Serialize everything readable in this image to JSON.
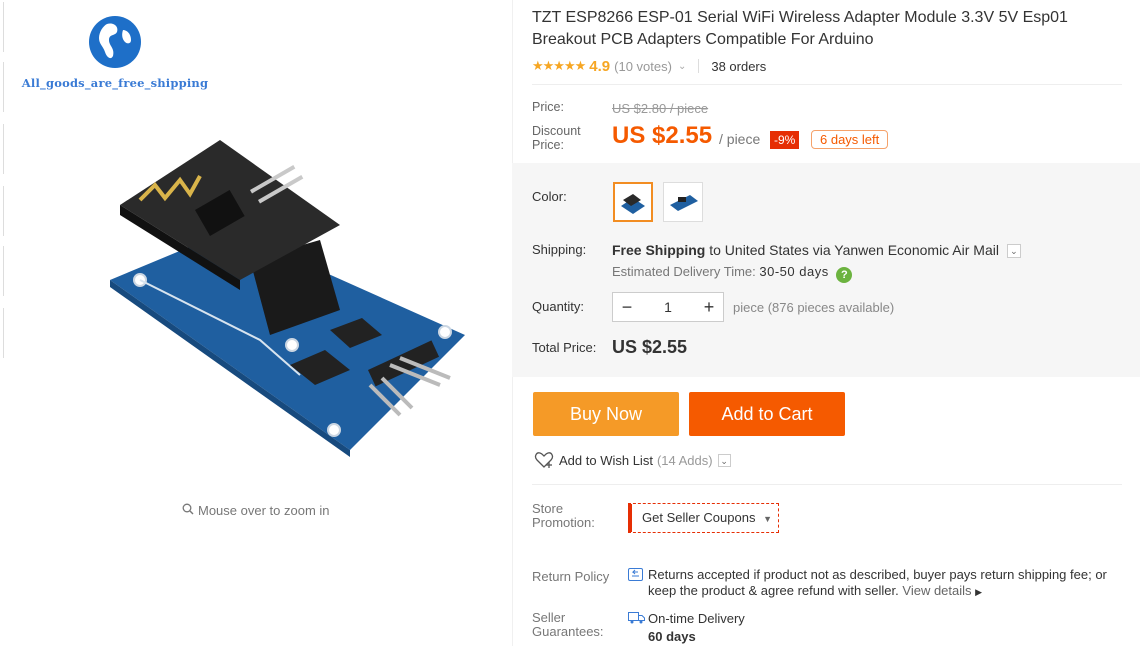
{
  "store": {
    "logo_text": "All_goods_are_free_shipping"
  },
  "gallery": {
    "zoom_hint": "Mouse over to zoom in"
  },
  "product": {
    "title": "TZT ESP8266 ESP-01 Serial WiFi Wireless Adapter Module 3.3V 5V Esp01 Breakout PCB Adapters Compatible For Arduino",
    "stars": "★★★★★",
    "rating": "4.9",
    "votes": "(10 votes)",
    "orders": "38 orders"
  },
  "price": {
    "label": "Price:",
    "original": "US $2.80 / piece",
    "discount_label": "Discount Price:",
    "discount": "US $2.55",
    "per_piece": "/ piece",
    "off": "-9%",
    "days_left": "6 days left"
  },
  "options": {
    "color_label": "Color:",
    "shipping_label": "Shipping:",
    "shipping_free": "Free Shipping",
    "shipping_rest": " to United States via Yanwen Economic Air Mail",
    "est_label": "Estimated Delivery Time: ",
    "est_days": "30-50 days",
    "help_glyph": "?",
    "qty_label": "Quantity:",
    "qty_minus": "−",
    "qty_value": "1",
    "qty_plus": "+",
    "qty_avail": "piece (876 pieces available)",
    "total_label": "Total Price:",
    "total_value": "US $2.55"
  },
  "actions": {
    "buy_now": "Buy Now",
    "add_to_cart": "Add to Cart",
    "wish_list": "Add to Wish List",
    "wish_count": "(14 Adds)"
  },
  "store_info": {
    "promo_label": "Store Promotion:",
    "coupons": "Get Seller Coupons",
    "return_label": "Return Policy",
    "return_text": "Returns accepted if product not as described, buyer pays return shipping fee; or keep the product & agree refund with seller.",
    "view_details": "View details",
    "guarantee_label": "Seller Guarantees:",
    "guarantee_title": "On-time Delivery",
    "guarantee_days": "60 days"
  },
  "colors": {
    "accent": "#f55a00",
    "buy": "#f59a27",
    "badge": "#e62e04",
    "star": "#f6a623"
  }
}
